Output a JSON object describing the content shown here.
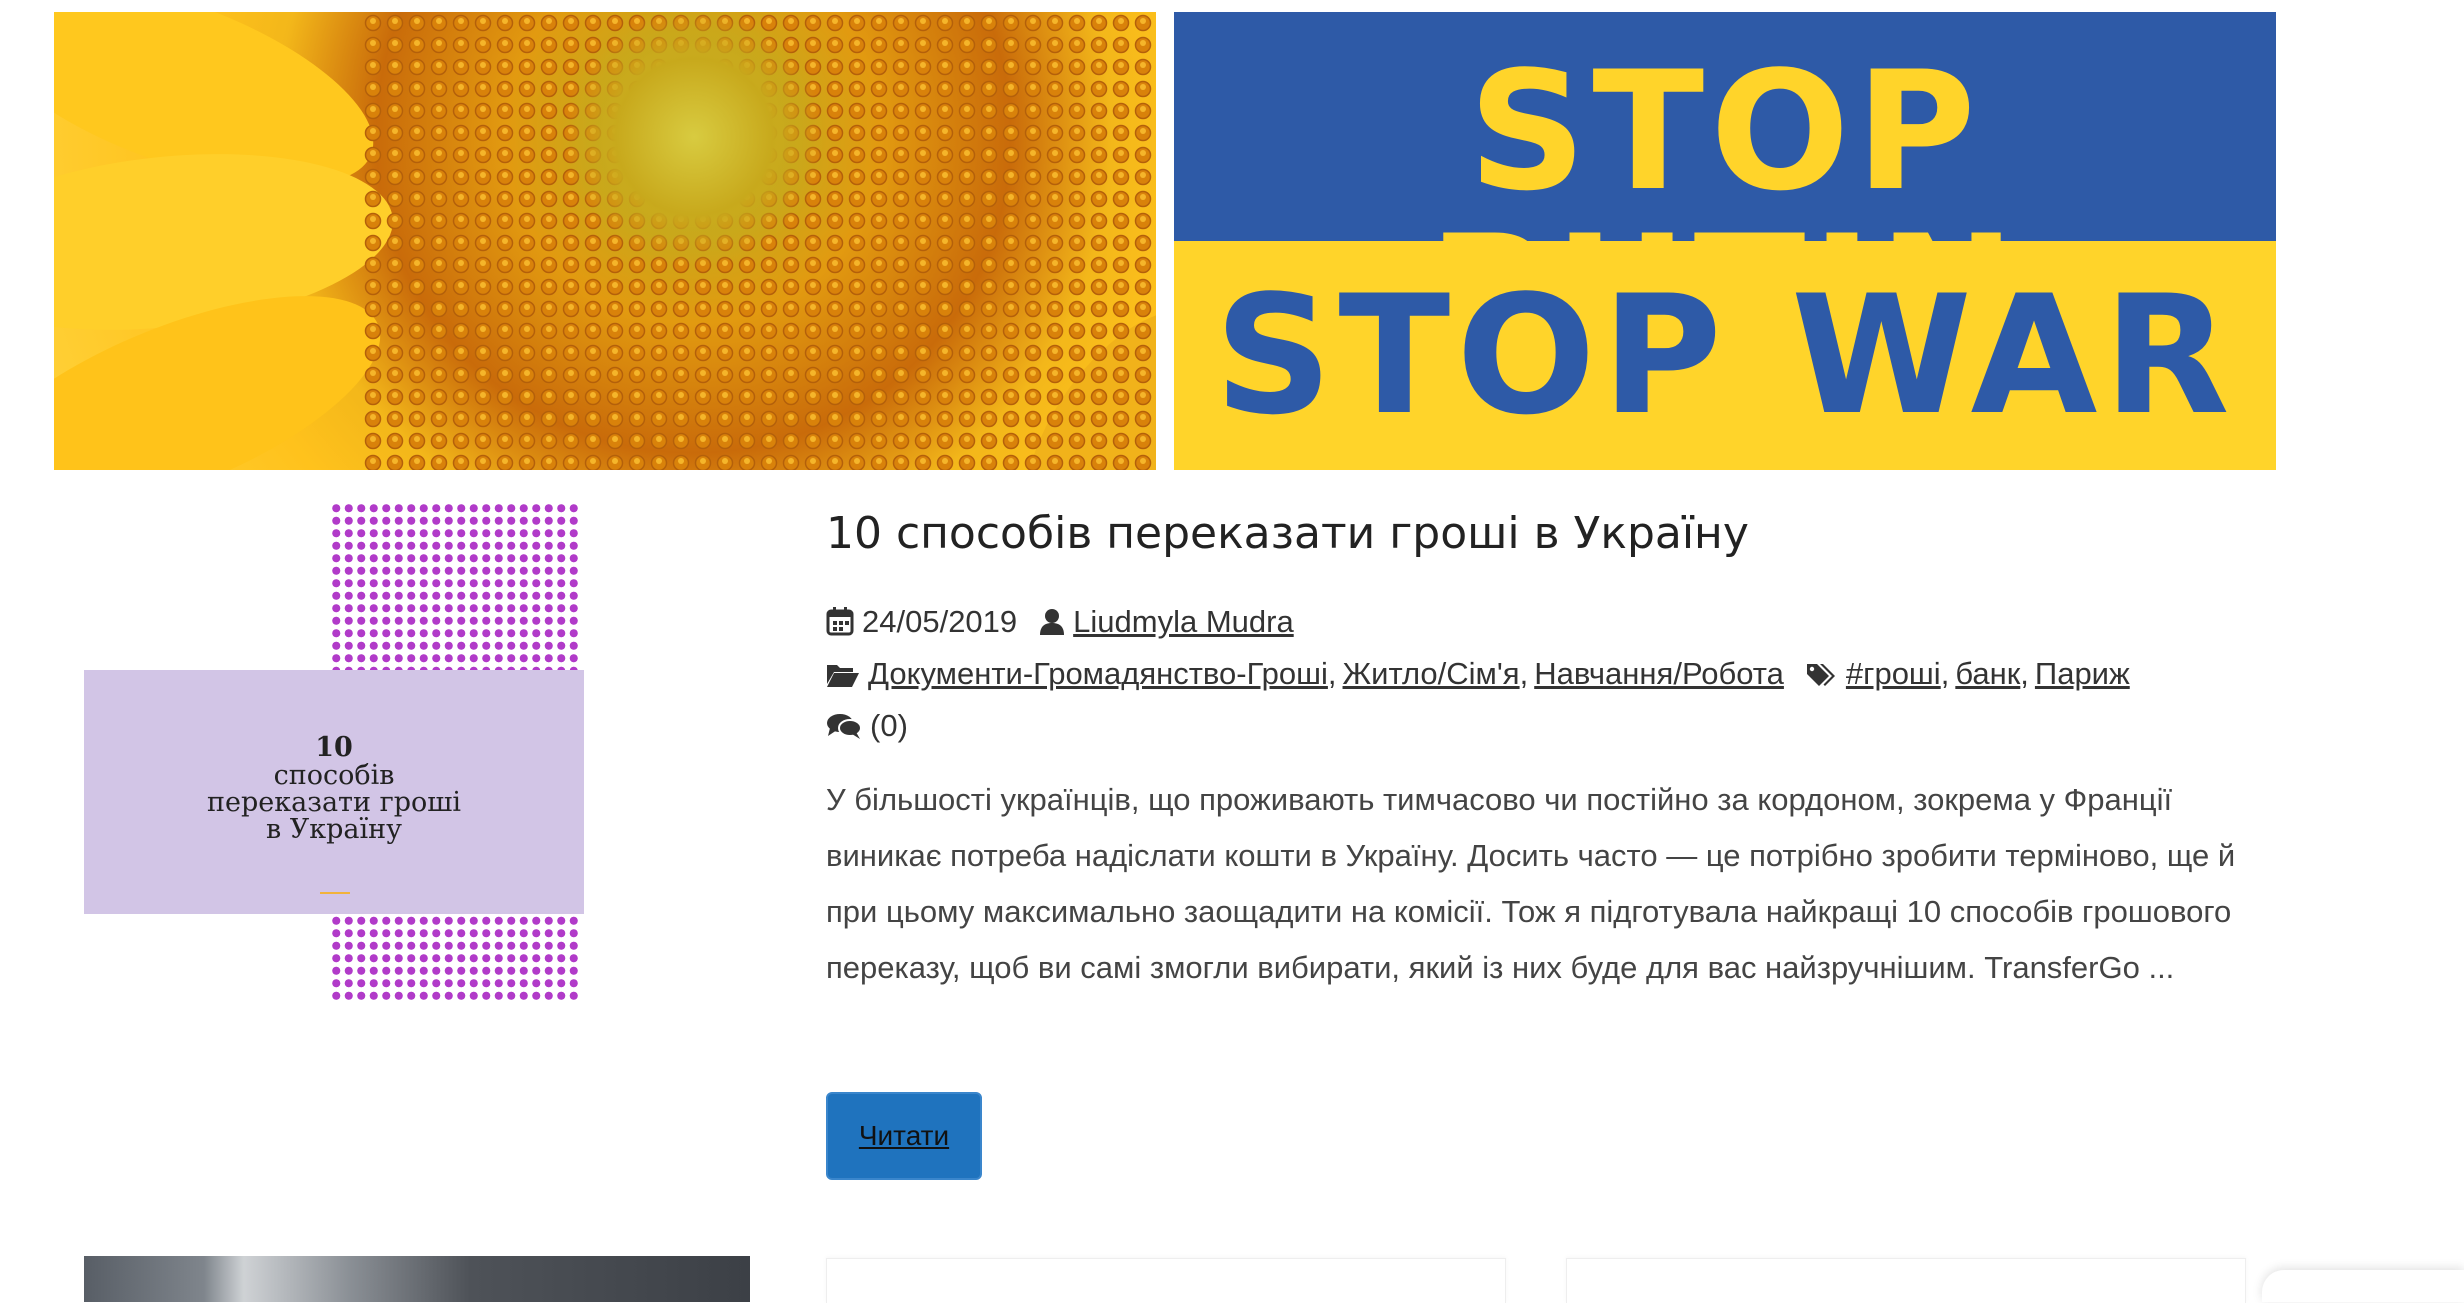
{
  "banners": {
    "sunflower": {
      "alt_icon": "sunflower-image"
    },
    "stop": {
      "line1": "STOP PUTIN",
      "line2": "STOP WAR",
      "colors": {
        "blue": "#2e5aa7",
        "yellow": "#ffd42a"
      }
    }
  },
  "post": {
    "thumbnail": {
      "number": "10",
      "line1": "способів",
      "line2": "переказати гроші",
      "line3": "в Україну",
      "colors": {
        "card": "#d2c5e6",
        "dots": "#b13bc9"
      }
    },
    "title": "10 способів переказати гроші в Україну",
    "date": "24/05/2019",
    "author": "Liudmyla Mudra",
    "categories": [
      "Документи-Громадянство-Гроші",
      "Житло/Сім'я",
      "Навчання/Робота"
    ],
    "tags": [
      "#гроші",
      "банк",
      "Париж"
    ],
    "comments": "(0)",
    "excerpt": "У більшості українців, що проживають тимчасово чи постійно за кордоном, зокрема у Франції виникає потреба надіслати кошти в Україну. Досить часто — це потрібно зробити терміново, ще й при цьому максимально заощадити на комісії. Тож я підготувала найкращі 10 способів грошового переказу, щоб ви самі змогли вибирати, який із них буде для вас найзручнішим. TransferGo ...",
    "read_more": "Читати",
    "colors": {
      "button": "#1f73be"
    }
  }
}
